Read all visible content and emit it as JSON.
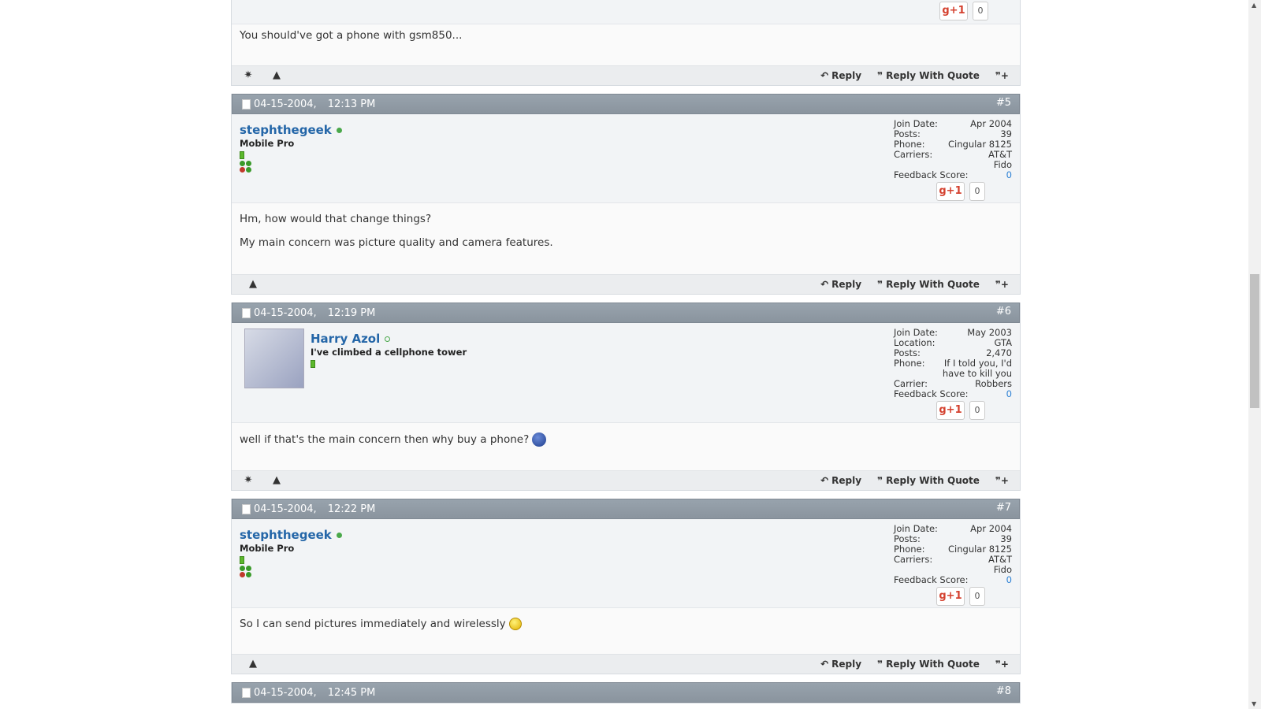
{
  "post4": {
    "gplus": "g+1",
    "count": "0",
    "message": "You should've got a phone with gsm850...",
    "reply": "Reply",
    "reply_quote": "Reply With Quote"
  },
  "post5": {
    "date": "04-15-2004,",
    "time": "12:13 PM",
    "number": "#5",
    "username": "stephthegeek",
    "usertitle": "Mobile Pro",
    "stats": [
      {
        "k": "Join Date:",
        "v": "Apr 2004"
      },
      {
        "k": "Posts:",
        "v": "39"
      },
      {
        "k": "Phone:",
        "v": "Cingular 8125"
      },
      {
        "k": "Carriers:",
        "v": "AT&T"
      },
      {
        "k": "",
        "v": "Fido"
      }
    ],
    "feedback_label": "Feedback Score:",
    "feedback": "0",
    "gplus": "g+1",
    "count": "0",
    "message1": "Hm, how would that change things?",
    "message2": "My main concern was picture quality and camera features.",
    "reply": "Reply",
    "reply_quote": "Reply With Quote"
  },
  "post6": {
    "date": "04-15-2004,",
    "time": "12:19 PM",
    "number": "#6",
    "username": "Harry Azol",
    "usertitle": "I've climbed a cellphone tower",
    "stats": [
      {
        "k": "Join Date:",
        "v": "May 2003"
      },
      {
        "k": "Location:",
        "v": "GTA"
      },
      {
        "k": "Posts:",
        "v": "2,470"
      },
      {
        "k": "Phone:",
        "v": "If I told you, I'd"
      },
      {
        "k": "",
        "v": "have to kill you"
      },
      {
        "k": "Carrier:",
        "v": "Robbers"
      }
    ],
    "feedback_label": "Feedback Score:",
    "feedback": "0",
    "gplus": "g+1",
    "count": "0",
    "message": "well if that's the main concern then why buy a phone?",
    "reply": "Reply",
    "reply_quote": "Reply With Quote"
  },
  "post7": {
    "date": "04-15-2004,",
    "time": "12:22 PM",
    "number": "#7",
    "username": "stephthegeek",
    "usertitle": "Mobile Pro",
    "stats": [
      {
        "k": "Join Date:",
        "v": "Apr 2004"
      },
      {
        "k": "Posts:",
        "v": "39"
      },
      {
        "k": "Phone:",
        "v": "Cingular 8125"
      },
      {
        "k": "Carriers:",
        "v": "AT&T"
      },
      {
        "k": "",
        "v": "Fido"
      }
    ],
    "feedback_label": "Feedback Score:",
    "feedback": "0",
    "gplus": "g+1",
    "count": "0",
    "message": "So I can send pictures immediately and wirelessly",
    "reply": "Reply",
    "reply_quote": "Reply With Quote"
  },
  "post8": {
    "date": "04-15-2004,",
    "time": "12:45 PM",
    "number": "#8"
  }
}
